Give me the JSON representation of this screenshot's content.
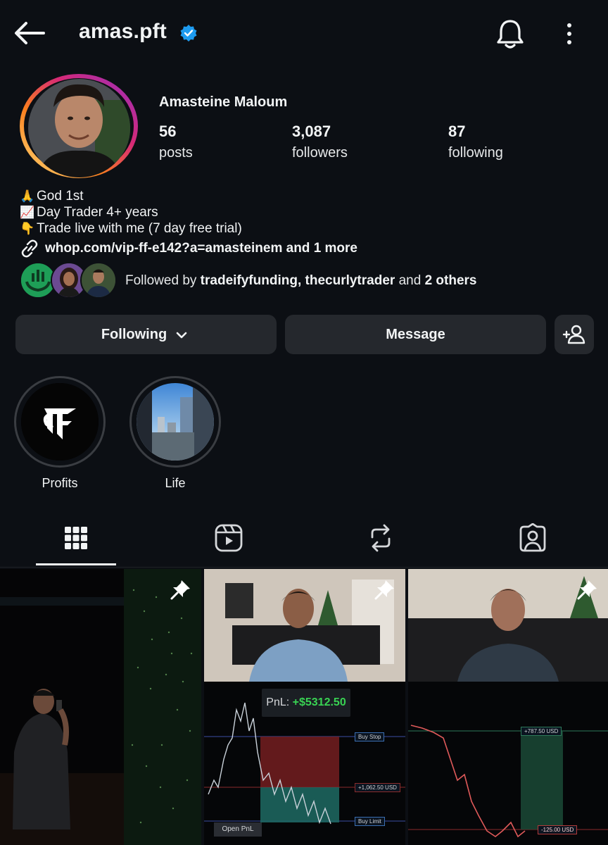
{
  "header": {
    "username": "amas.pft"
  },
  "profile": {
    "full_name": "Amasteine Maloum",
    "stats": [
      {
        "value": "56",
        "label": "posts"
      },
      {
        "value": "3,087",
        "label": "followers"
      },
      {
        "value": "87",
        "label": "following"
      }
    ],
    "bio": [
      {
        "emoji": "🙏",
        "text": "God 1st"
      },
      {
        "emoji": "📈",
        "text": "Day Trader 4+ years"
      },
      {
        "emoji": "👇",
        "text": "Trade live with me (7 day free trial)"
      }
    ],
    "link": "whop.com/vip-ff-e142?a=amasteinem and 1 more",
    "followed_by": {
      "prefix": "Followed by ",
      "user1": "tradeifyfunding",
      "sep": ", ",
      "user2": "thecurlytrader",
      "and": " and ",
      "others": "2 others"
    }
  },
  "actions": {
    "following_label": "Following",
    "message_label": "Message"
  },
  "highlights": [
    {
      "label": "Profits"
    },
    {
      "label": "Life"
    }
  ],
  "posts": {
    "pnl_label": "PnL: ",
    "pnl_value": "+$5312.50",
    "open_pnl_label": "Open PnL",
    "chart2_tags": [
      "+787.50 USD",
      "-125.00 USD"
    ],
    "chart1_tags": [
      "Buy Stop",
      "+1,062.50 USD",
      "Buy Limit"
    ]
  },
  "colors": {
    "verified": "#1d9bf0",
    "background": "#0c0f14",
    "button": "#25282d",
    "gain": "#39d353"
  }
}
